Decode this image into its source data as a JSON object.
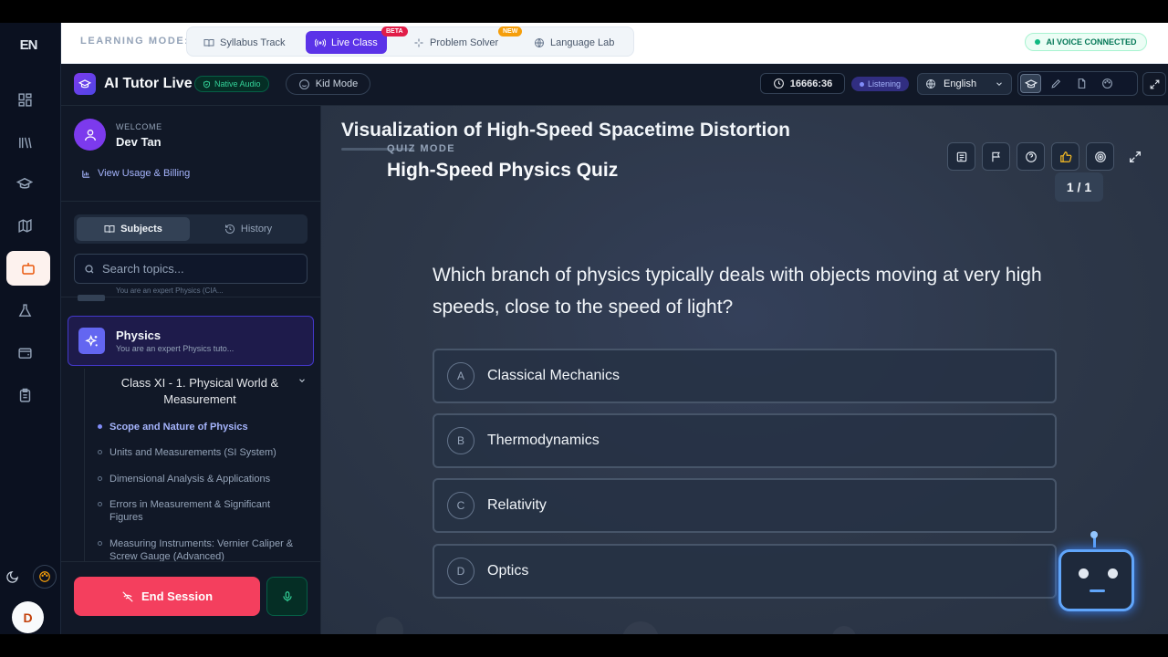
{
  "rail": {
    "logo": "EN",
    "icons": [
      "grid-icon",
      "library-icon",
      "graduation-cap-icon",
      "map-icon",
      "robot-icon",
      "flask-icon",
      "wallet-icon",
      "clipboard-icon"
    ],
    "active_icon": "robot-icon",
    "avatar_letter": "D"
  },
  "topbar": {
    "learning_mode_label": "LEARNING MODE:",
    "modes": [
      {
        "label": "Syllabus Track",
        "icon": "book-icon",
        "active": false
      },
      {
        "label": "Live Class",
        "icon": "broadcast-icon",
        "active": true,
        "tag": "BETA"
      },
      {
        "label": "Problem Solver",
        "icon": "sparkle-icon",
        "active": false,
        "tag": "NEW"
      },
      {
        "label": "Language Lab",
        "icon": "globe-icon",
        "active": false
      }
    ],
    "voice_status": "AI VOICE CONNECTED"
  },
  "header": {
    "title": "AI Tutor Live",
    "native_audio": "Native Audio",
    "kid_mode": "Kid Mode",
    "timer": "16666:36",
    "listening": "Listening",
    "language": "English",
    "tools": [
      "graduation-cap-icon",
      "pen-icon",
      "file-icon",
      "palette-icon"
    ]
  },
  "sidebar": {
    "welcome": "WELCOME",
    "user_name": "Dev Tan",
    "billing": "View Usage & Billing",
    "tabs": {
      "subjects": "Subjects",
      "history": "History"
    },
    "search_placeholder": "Search topics...",
    "peek_text": "You are an expert Physics (CIA...",
    "subject": {
      "name": "Physics",
      "desc": "You are an expert Physics tuto..."
    },
    "chapter": "Class XI - 1. Physical World & Measurement",
    "topics": [
      {
        "label": "Scope and Nature of Physics",
        "active": true
      },
      {
        "label": "Units and Measurements (SI System)",
        "active": false
      },
      {
        "label": "Dimensional Analysis & Applications",
        "active": false
      },
      {
        "label": "Errors in Measurement & Significant Figures",
        "active": false
      },
      {
        "label": "Measuring Instruments: Vernier Caliper & Screw Gauge (Advanced)",
        "active": false
      }
    ],
    "end_session": "End Session"
  },
  "main": {
    "viz_title": "Visualization of High-Speed Spacetime Distortion",
    "quiz_mode": "QUIZ MODE",
    "quiz_title": "High-Speed Physics Quiz",
    "counter": "1 / 1",
    "question": "Which branch of physics typically deals with objects moving at very high speeds, close to the speed of light?",
    "options": [
      {
        "letter": "A",
        "text": "Classical Mechanics"
      },
      {
        "letter": "B",
        "text": "Thermodynamics"
      },
      {
        "letter": "C",
        "text": "Relativity"
      },
      {
        "letter": "D",
        "text": "Optics"
      }
    ],
    "controls": [
      "notes-icon",
      "flag-icon",
      "help-icon",
      "thumbs-up-icon",
      "target-icon",
      "fullscreen-icon"
    ]
  },
  "colors": {
    "accent": "#5b33e8",
    "danger": "#f43f5e",
    "success": "#10b981",
    "main_bg": "#2d3748"
  }
}
